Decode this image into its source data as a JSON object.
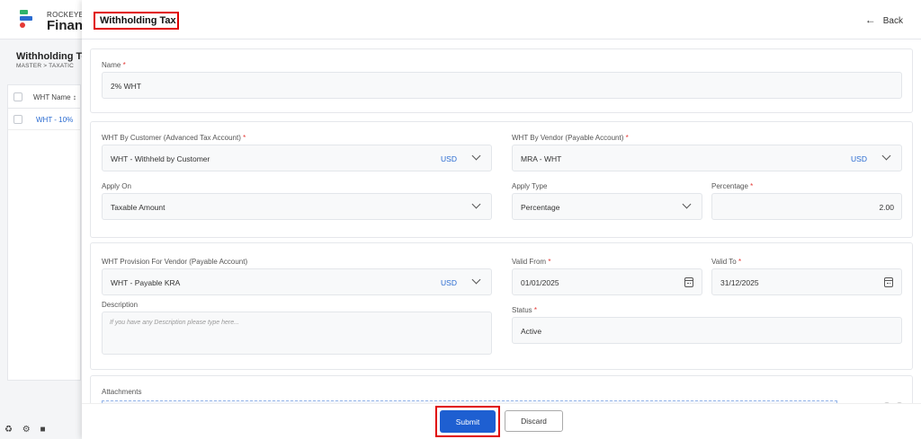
{
  "background": {
    "brand_top": "ROCKEYE",
    "brand_main": "Financ",
    "page_title": "Withholding To",
    "breadcrumb": "MASTER  >  TAXATIC",
    "table_header": "WHT Name  ↕",
    "table_rows": [
      "WHT - 10%"
    ],
    "footer_icons": [
      "♻",
      "⚙",
      "■"
    ]
  },
  "drawer": {
    "title": "Withholding Tax",
    "back_label": "Back"
  },
  "form": {
    "name": {
      "label": "Name",
      "value": "2% WHT"
    },
    "wht_customer": {
      "label": "WHT By Customer (Advanced Tax Account)",
      "value": "WHT - Withheld by Customer",
      "currency": "USD"
    },
    "wht_vendor": {
      "label": "WHT By Vendor (Payable Account)",
      "value": "MRA - WHT",
      "currency": "USD"
    },
    "apply_on": {
      "label": "Apply On",
      "value": "Taxable Amount"
    },
    "apply_type": {
      "label": "Apply Type",
      "value": "Percentage"
    },
    "percentage": {
      "label": "Percentage",
      "value": "2.00"
    },
    "wht_provision": {
      "label": "WHT Provision For Vendor (Payable Account)",
      "value": "WHT - Payable KRA",
      "currency": "USD"
    },
    "valid_from": {
      "label": "Valid From",
      "value": "01/01/2025"
    },
    "valid_to": {
      "label": "Valid To",
      "value": "31/12/2025"
    },
    "description": {
      "label": "Description",
      "placeholder": "If you have any Description please type here..."
    },
    "status": {
      "label": "Status",
      "value": "Active"
    },
    "attachments": {
      "label": "Attachments"
    }
  },
  "footer": {
    "submit_label": "Submit",
    "discard_label": "Discard"
  },
  "required_mark": "*",
  "colors": {
    "accent": "#1e5fd1",
    "highlight": "#e00000",
    "required": "#e53935"
  }
}
